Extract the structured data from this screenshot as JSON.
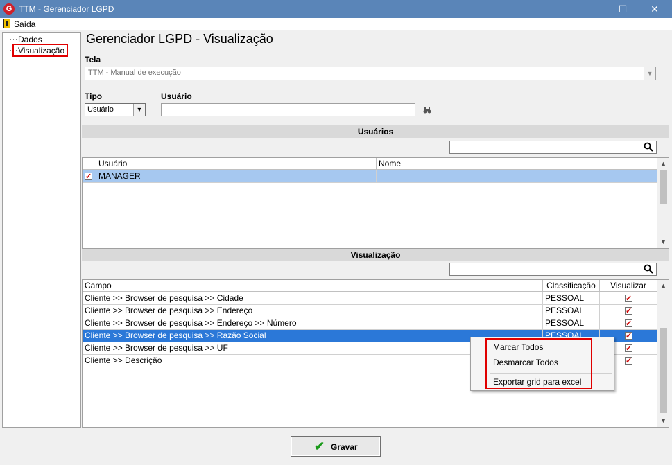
{
  "window": {
    "title": "TTM - Gerenciador LGPD",
    "app_icon": "G",
    "minimize": "—",
    "maximize": "☐",
    "close": "✕"
  },
  "menu": {
    "exit_label": "Saída"
  },
  "sidebar": {
    "items": [
      {
        "label": "Dados"
      },
      {
        "label": "Visualização"
      }
    ]
  },
  "page": {
    "title": "Gerenciador LGPD - Visualização"
  },
  "form": {
    "tela_label": "Tela",
    "tela_value": "TTM - Manual de execução",
    "tipo_label": "Tipo",
    "tipo_value": "Usuário",
    "usuario_label": "Usuário",
    "usuario_value": ""
  },
  "users_section": {
    "title": "Usuários",
    "search_value": "",
    "columns": [
      "Usuário",
      "Nome"
    ],
    "rows": [
      {
        "usuario": "MANAGER",
        "nome": "",
        "checked": true
      }
    ]
  },
  "view_section": {
    "title": "Visualização",
    "search_value": "",
    "columns": [
      "Campo",
      "Classificação",
      "Visualizar"
    ],
    "rows": [
      {
        "campo": "Cliente >> Browser de pesquisa >> Cidade",
        "classificacao": "PESSOAL",
        "visualizar": true
      },
      {
        "campo": "Cliente >> Browser de pesquisa >> Endereço",
        "classificacao": "PESSOAL",
        "visualizar": true
      },
      {
        "campo": "Cliente >> Browser de pesquisa >> Endereço >> Número",
        "classificacao": "PESSOAL",
        "visualizar": true
      },
      {
        "campo": "Cliente >> Browser de pesquisa >> Razão Social",
        "classificacao": "PESSOAL",
        "visualizar": true
      },
      {
        "campo": "Cliente >> Browser de pesquisa >> UF",
        "classificacao": "",
        "visualizar": true
      },
      {
        "campo": "Cliente >> Descrição",
        "classificacao": "",
        "visualizar": true
      }
    ]
  },
  "context_menu": {
    "items": [
      "Marcar Todos",
      "Desmarcar Todos",
      "Exportar grid para excel"
    ]
  },
  "footer": {
    "save_label": "Gravar"
  },
  "colors": {
    "title_bar": "#5a85b8",
    "selection_dark": "#2b78d8",
    "selection_light": "#a6c8f0",
    "highlight_red": "#e00000"
  }
}
